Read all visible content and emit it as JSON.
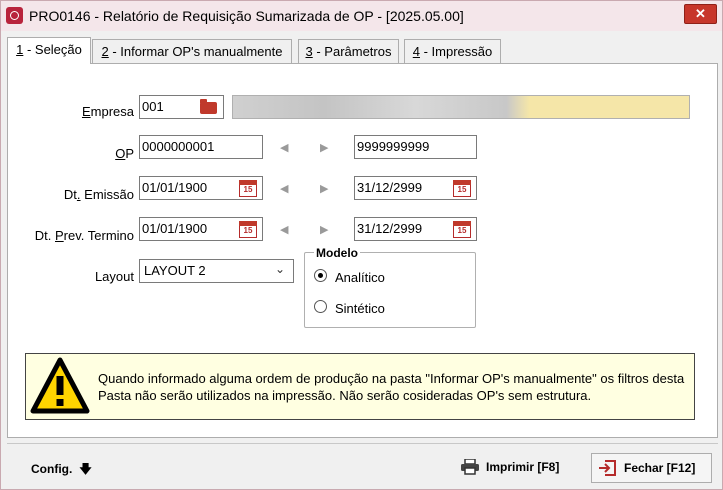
{
  "window": {
    "title": "PRO0146 - Relatório de Requisição Sumarizada de OP - [2025.05.00]",
    "close_glyph": "✕"
  },
  "tabs": [
    {
      "key": "1",
      "label": " - Seleção"
    },
    {
      "key": "2",
      "label": " - Informar OP's manualmente"
    },
    {
      "key": "3",
      "label": " - Parâmetros"
    },
    {
      "key": "4",
      "label": " - Impressão"
    }
  ],
  "form": {
    "empresa": {
      "label_u": "E",
      "label_rest": "mpresa",
      "value": "001"
    },
    "op": {
      "label_u": "O",
      "label_rest": "P",
      "from": "0000000001",
      "to": "9999999999"
    },
    "dt_emissao": {
      "label_pre": "Dt",
      "label_u": ".",
      "label_rest": " Emissão",
      "from": "01/01/1900",
      "to": "31/12/2999"
    },
    "dt_prev": {
      "label_pre": "Dt. ",
      "label_u": "P",
      "label_rest": "rev. Termino",
      "from": "01/01/1900",
      "to": "31/12/2999"
    },
    "layout": {
      "label": "Layout",
      "value": "LAYOUT 2"
    },
    "modelo": {
      "title": "Modelo",
      "options": [
        "Analítico",
        "Sintético"
      ],
      "selected": "Analítico"
    }
  },
  "calendar_icon_text": "15",
  "arrows": {
    "left": "◀",
    "right": "▶"
  },
  "warning": {
    "text": "Quando informado alguma ordem de produção na pasta \"Informar OP's manualmente\" os filtros desta Pasta não serão utilizados na impressão. Não serão cosideradas OP's sem estrutura."
  },
  "footer": {
    "config_label": "Config.",
    "config_arrow": "🡇",
    "print_label": "Imprimir [F8]",
    "close_label": "Fechar [F12]"
  },
  "icons": [
    "app-icon",
    "close-icon",
    "folder-icon",
    "calendar-icon",
    "arrow-left-icon",
    "arrow-right-icon",
    "chevron-down-icon",
    "warning-icon",
    "printer-icon",
    "exit-icon"
  ],
  "colors": {
    "accent": "#b8233c",
    "warning_bg": "#ffffe1",
    "empresa_highlight": "#f5e6a8"
  }
}
